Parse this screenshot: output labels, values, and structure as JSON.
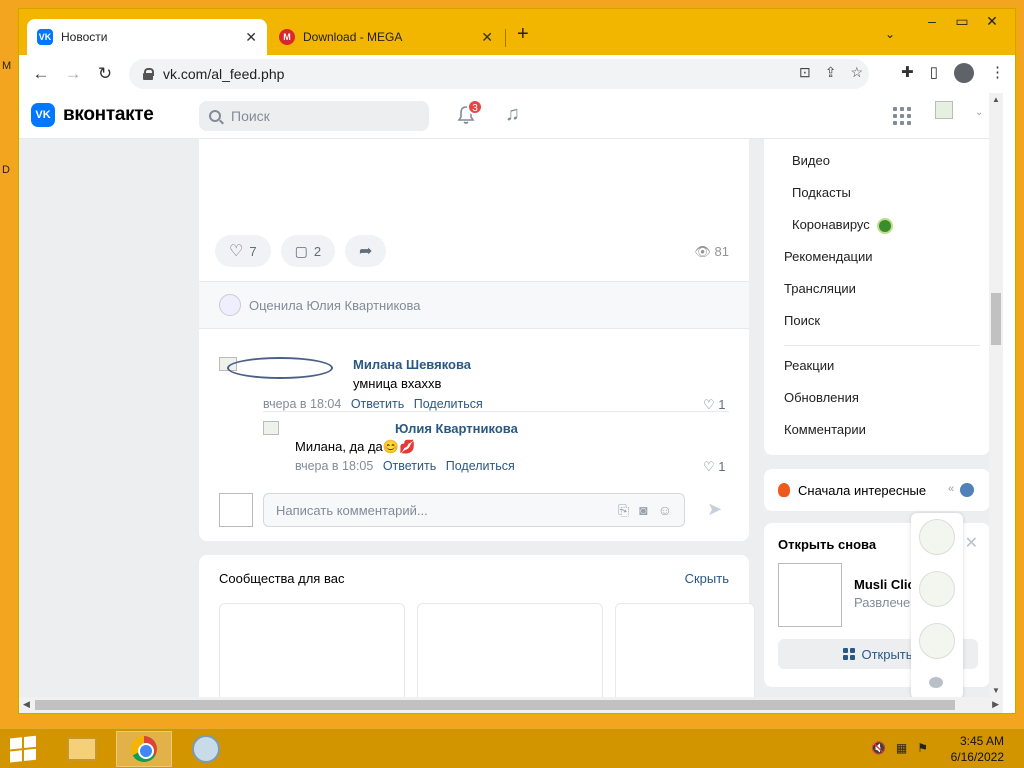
{
  "browser": {
    "tabs": [
      {
        "title": "Новости",
        "favicon": "VK",
        "active": true
      },
      {
        "title": "Download - MEGA",
        "favicon": "M",
        "active": false
      }
    ],
    "url": "vk.com/al_feed.php"
  },
  "vk": {
    "logo_text": "вконтакте",
    "logo_mark": "VK",
    "search_placeholder": "Поиск",
    "notifications_count": "3",
    "post": {
      "likes": "7",
      "comments": "2",
      "views": "81",
      "liked_by": "Оценила Юлия Квартникова",
      "comments_list": [
        {
          "author": "Милана Шевякова",
          "text": "умница вхаххв",
          "time": "вчера в 18:04",
          "reply": "Ответить",
          "share": "Поделиться",
          "likes": "1"
        },
        {
          "author": "Юлия Квартникова",
          "text": "Милана, да да😊💋",
          "time": "вчера в 18:05",
          "reply": "Ответить",
          "share": "Поделиться",
          "likes": "1"
        }
      ],
      "comment_placeholder": "Написать комментарий..."
    },
    "communities": {
      "title": "Сообщества для вас",
      "hide": "Скрыть"
    },
    "right_menu": {
      "sub_items": [
        "Видео",
        "Подкасты",
        "Коронавирус"
      ],
      "items": [
        "Рекомендации",
        "Трансляции",
        "Поиск"
      ],
      "items2": [
        "Реакции",
        "Обновления",
        "Комментарии"
      ]
    },
    "sort": {
      "label": "Сначала интересные"
    },
    "reopen": {
      "title": "Открыть снова",
      "name": "Musli Clic",
      "subtitle": "Развлече",
      "button": "Открыть"
    }
  },
  "taskbar": {
    "time": "3:45 AM",
    "date": "6/16/2022"
  },
  "desktop_edge": [
    "M",
    "D"
  ]
}
